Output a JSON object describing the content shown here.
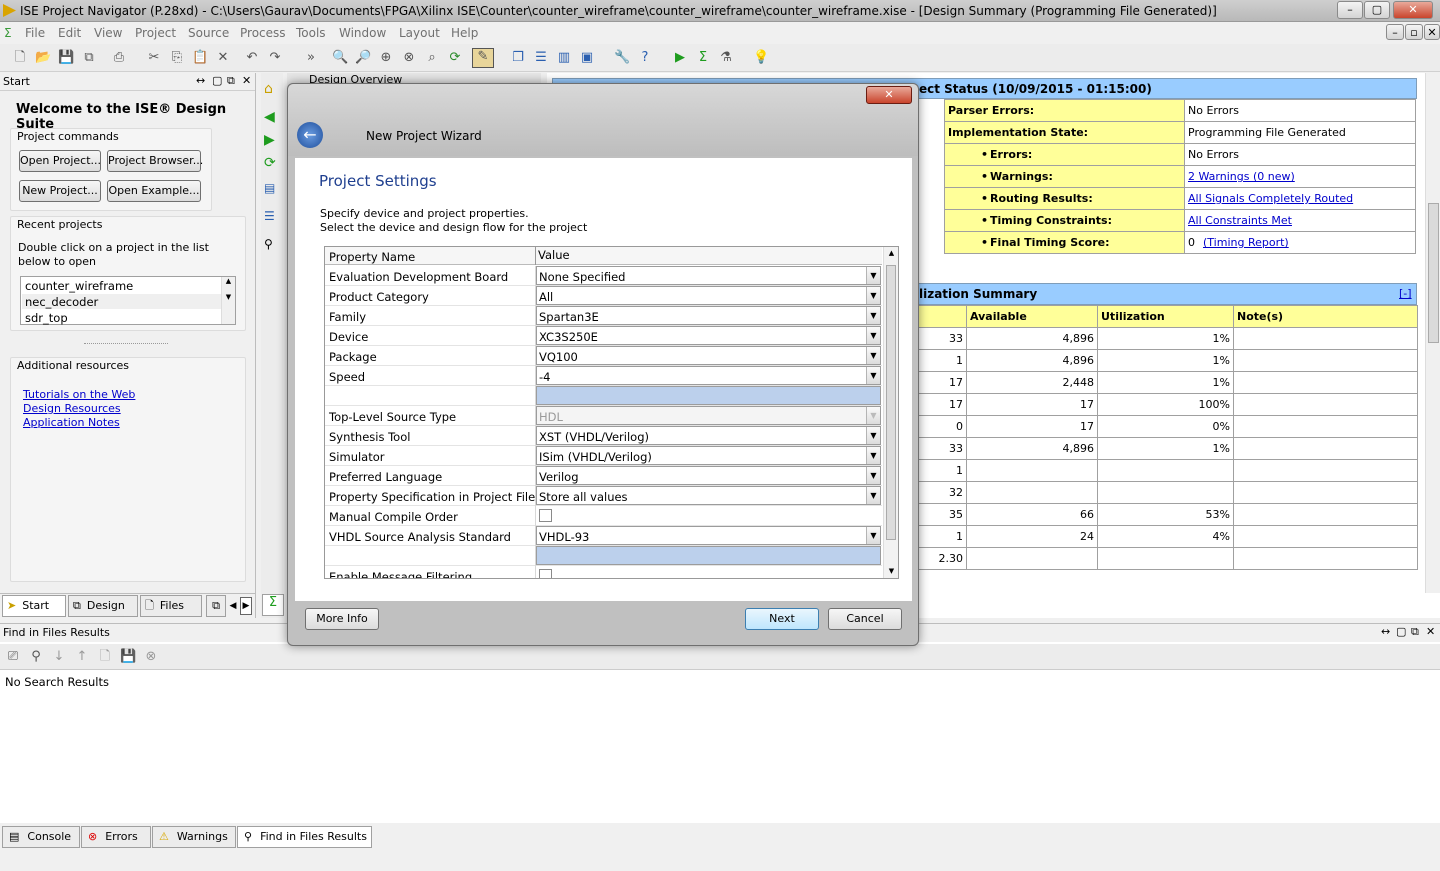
{
  "window": {
    "title": "ISE Project Navigator (P.28xd) - C:\\Users\\Gaurav\\Documents\\FPGA\\Xilinx ISE\\Counter\\counter_wireframe\\counter_wireframe\\counter_wireframe.xise - [Design Summary (Programming File Generated)]"
  },
  "menu": [
    "File",
    "Edit",
    "View",
    "Project",
    "Source",
    "Process",
    "Tools",
    "Window",
    "Layout",
    "Help"
  ],
  "start_panel": {
    "title": "Start",
    "welcome": "Welcome to the ISE® Design Suite",
    "project_commands": "Project commands",
    "btn_open_project": "Open Project...",
    "btn_project_browser": "Project Browser...",
    "btn_new_project": "New Project...",
    "btn_open_example": "Open Example...",
    "recent_projects": "Recent projects",
    "recent_hint": "Double click on a project in the list below to open",
    "recent_list": [
      "counter_wireframe",
      "nec_decoder",
      "sdr_top"
    ],
    "additional_resources": "Additional resources",
    "links": [
      "Tutorials on the Web",
      "Design Resources",
      "Application Notes"
    ],
    "tabs": [
      "Start",
      "Design",
      "Files"
    ]
  },
  "design_overview": {
    "title": "Design Overview"
  },
  "summary": {
    "status_header": "ect Status (10/09/2015 - 01:15:00)",
    "rows": [
      {
        "label": "Parser Errors:",
        "value": "No Errors",
        "link": false,
        "bullet": false
      },
      {
        "label": "Implementation State:",
        "value": "Programming File Generated",
        "link": false,
        "bullet": false
      },
      {
        "label": "Errors:",
        "value": "No Errors",
        "link": false,
        "bullet": true
      },
      {
        "label": "Warnings:",
        "value": "2 Warnings (0 new)",
        "link": true,
        "bullet": true
      },
      {
        "label": "Routing Results:",
        "value": "All Signals Completely Routed",
        "link": true,
        "bullet": true
      },
      {
        "label": "Timing Constraints:",
        "value": "All Constraints Met",
        "link": true,
        "bullet": true
      },
      {
        "label": "Final Timing Score:",
        "value": "0",
        "extra": "(Timing Report)",
        "link": false,
        "bullet": true
      }
    ],
    "util_header": "lization Summary",
    "collapse": "[-]",
    "util_cols": [
      "Available",
      "Utilization",
      "Note(s)"
    ],
    "util_rows": [
      [
        "33",
        "4,896",
        "1%"
      ],
      [
        "1",
        "4,896",
        "1%"
      ],
      [
        "17",
        "2,448",
        "1%"
      ],
      [
        "17",
        "17",
        "100%"
      ],
      [
        "0",
        "17",
        "0%"
      ],
      [
        "33",
        "4,896",
        "1%"
      ],
      [
        "1",
        "",
        ""
      ],
      [
        "32",
        "",
        ""
      ],
      [
        "35",
        "66",
        "53%"
      ],
      [
        "1",
        "24",
        "4%"
      ],
      [
        "2.30",
        "",
        ""
      ]
    ]
  },
  "find_panel": {
    "title": "Find in Files Results",
    "no_results": "No Search Results"
  },
  "bottom_tabs": [
    "Console",
    "Errors",
    "Warnings",
    "Find in Files Results"
  ],
  "dialog": {
    "wizard_title": "New Project Wizard",
    "heading": "Project Settings",
    "desc1": "Specify device and project properties.",
    "desc2": "Select the device and design flow for the project",
    "col_name": "Property Name",
    "col_value": "Value",
    "rows": [
      {
        "name": "Evaluation Development Board",
        "value": "None Specified",
        "type": "dd"
      },
      {
        "name": "Product Category",
        "value": "All",
        "type": "dd"
      },
      {
        "name": "Family",
        "value": "Spartan3E",
        "type": "dd"
      },
      {
        "name": "Device",
        "value": "XC3S250E",
        "type": "dd"
      },
      {
        "name": "Package",
        "value": "VQ100",
        "type": "dd"
      },
      {
        "name": "Speed",
        "value": "-4",
        "type": "dd"
      },
      {
        "name": "",
        "value": "",
        "type": "sep"
      },
      {
        "name": "Top-Level Source Type",
        "value": "HDL",
        "type": "dis"
      },
      {
        "name": "Synthesis Tool",
        "value": "XST (VHDL/Verilog)",
        "type": "dd"
      },
      {
        "name": "Simulator",
        "value": "ISim (VHDL/Verilog)",
        "type": "dd"
      },
      {
        "name": "Preferred Language",
        "value": "Verilog",
        "type": "dd"
      },
      {
        "name": "Property Specification in Project File",
        "value": "Store all values",
        "type": "dd"
      },
      {
        "name": "Manual Compile Order",
        "value": "",
        "type": "chk"
      },
      {
        "name": "VHDL Source Analysis Standard",
        "value": "VHDL-93",
        "type": "dd"
      },
      {
        "name": "",
        "value": "",
        "type": "sep"
      },
      {
        "name": "Enable Message Filtering",
        "value": "",
        "type": "chk"
      }
    ],
    "btn_more_info": "More Info",
    "btn_next": "Next",
    "btn_cancel": "Cancel",
    "close": "✕"
  }
}
